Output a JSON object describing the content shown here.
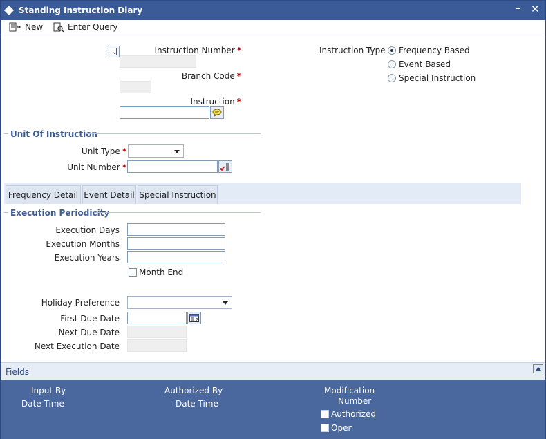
{
  "window": {
    "title": "Standing Instruction Diary",
    "minimize_glyph": "–",
    "close_glyph": "✕"
  },
  "toolbar": {
    "new_label": "New",
    "enter_query_label": "Enter Query"
  },
  "header": {
    "instruction_number_label": "Instruction Number",
    "branch_code_label": "Branch Code",
    "instruction_label": "Instruction",
    "instruction_number_value": "",
    "branch_code_value": "",
    "instruction_value": "",
    "instruction_type_label": "Instruction Type",
    "instruction_type_options": [
      "Frequency Based",
      "Event Based",
      "Special Instruction"
    ],
    "instruction_type_selected": "Frequency Based",
    "required_mark": "*"
  },
  "unit_of_instruction": {
    "title": "Unit Of Instruction",
    "unit_type_label": "Unit Type",
    "unit_type_value": "",
    "unit_number_label": "Unit Number",
    "unit_number_value": ""
  },
  "tabs": [
    {
      "label": "Frequency Detail"
    },
    {
      "label": "Event Detail"
    },
    {
      "label": "Special Instruction"
    }
  ],
  "execution_periodicity": {
    "title": "Execution Periodicity",
    "days_label": "Execution Days",
    "months_label": "Execution Months",
    "years_label": "Execution Years",
    "month_end_label": "Month End",
    "holiday_preference_label": "Holiday Preference",
    "holiday_preference_value": "",
    "first_due_date_label": "First Due Date",
    "next_due_date_label": "Next Due Date",
    "next_execution_date_label": "Next Execution Date"
  },
  "fields_bar": {
    "label": "Fields"
  },
  "audit": {
    "input_by_label": "Input By",
    "date_time_label_1": "Date Time",
    "authorized_by_label": "Authorized By",
    "date_time_label_2": "Date Time",
    "modification_label": "Modification",
    "number_label": "Number",
    "authorized_label": "Authorized",
    "open_label": "Open"
  },
  "colors": {
    "title_bar": "#3a5b97",
    "section_title": "#3d5c92",
    "audit_bg": "#4a689e",
    "required": "#c00000"
  }
}
